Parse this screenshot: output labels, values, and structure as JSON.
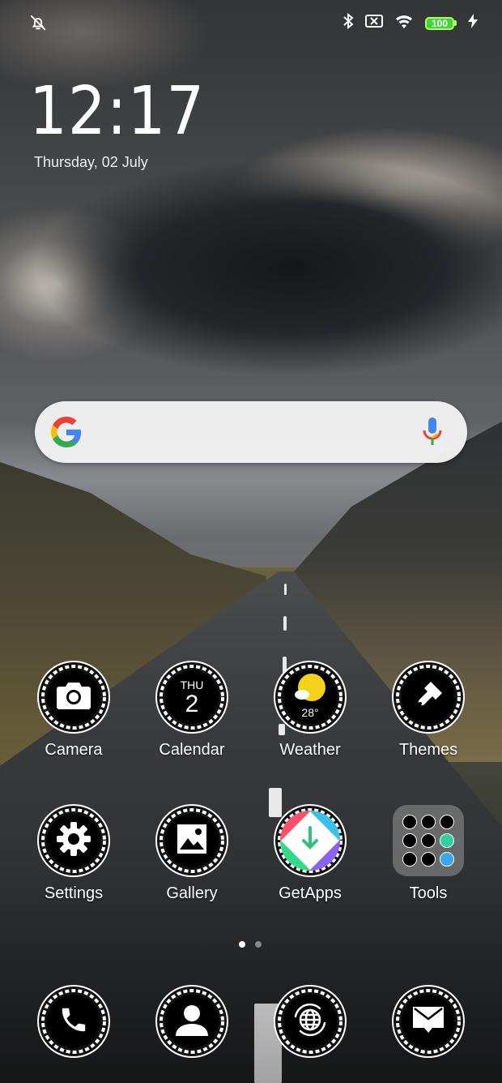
{
  "status_bar": {
    "left_icon": "alarm-off-icon",
    "right_icons": [
      "bluetooth-icon",
      "no-sim-icon",
      "wifi-icon"
    ],
    "battery_level": "100",
    "charging_icon": "lightning-icon"
  },
  "clock": {
    "time": "12:17",
    "date": "Thursday, 02 July"
  },
  "search_bar": {
    "left_icon": "google-g-icon",
    "right_icon": "mic-icon"
  },
  "home_apps": [
    {
      "label": "Camera",
      "icon": "camera-icon"
    },
    {
      "label": "Calendar",
      "icon": "calendar-icon",
      "day_abbr": "THU",
      "day_number": "2"
    },
    {
      "label": "Weather",
      "icon": "weather-sun-icon",
      "temperature": "28°"
    },
    {
      "label": "Themes",
      "icon": "paintbrush-icon"
    },
    {
      "label": "Settings",
      "icon": "gear-icon"
    },
    {
      "label": "Gallery",
      "icon": "picture-icon"
    },
    {
      "label": "GetApps",
      "icon": "getapps-icon"
    },
    {
      "label": "Tools",
      "icon": "folder-icon"
    }
  ],
  "pager": {
    "pages": 2,
    "current": 1
  },
  "dock": [
    {
      "icon": "phone-icon"
    },
    {
      "icon": "contacts-icon"
    },
    {
      "icon": "browser-icon"
    },
    {
      "icon": "messages-icon"
    }
  ],
  "colors": {
    "battery_green": "#46d33a",
    "google_blue": "#4285F4",
    "google_red": "#EA4335",
    "google_yellow": "#FBBC05",
    "google_green": "#34A853"
  }
}
